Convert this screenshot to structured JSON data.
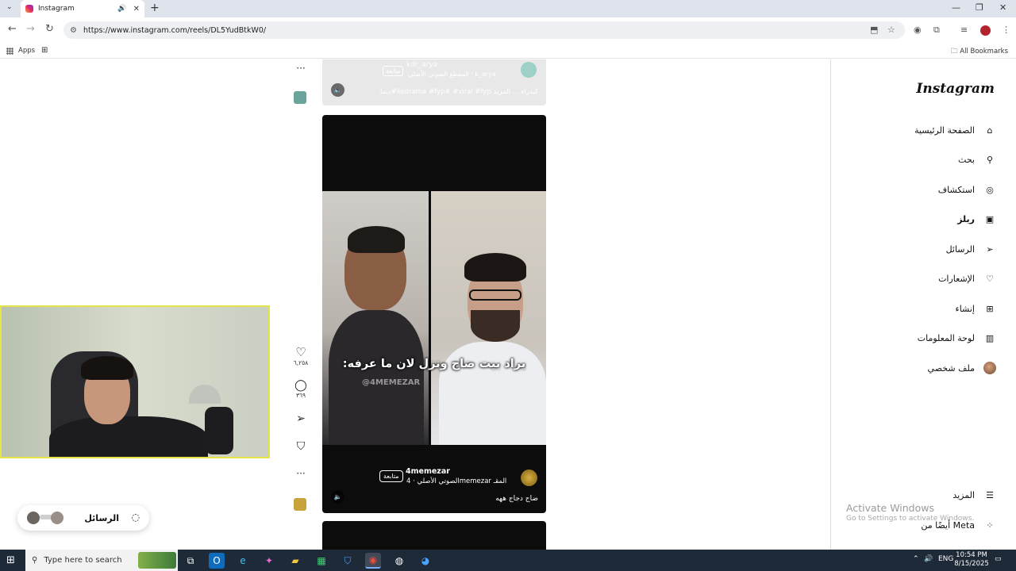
{
  "browser": {
    "tab_title": "Instagram",
    "url": "https://www.instagram.com/reels/DL5YudBtkW0/",
    "bookmarks": {
      "apps_label": "Apps",
      "all_bookmarks_label": "All Bookmarks"
    }
  },
  "sidebar": {
    "logo": "Instagram",
    "items": [
      {
        "label": "الصفحة الرئيسية",
        "icon": "home-icon",
        "glyph": "⌂"
      },
      {
        "label": "بحث",
        "icon": "search-icon",
        "glyph": "⚲"
      },
      {
        "label": "استكشاف",
        "icon": "compass-icon",
        "glyph": "◎"
      },
      {
        "label": "ريلز",
        "icon": "reels-icon",
        "glyph": "▣"
      },
      {
        "label": "الرسائل",
        "icon": "send-icon",
        "glyph": "➢"
      },
      {
        "label": "الإشعارات",
        "icon": "heart-icon",
        "glyph": "♡"
      },
      {
        "label": "إنشاء",
        "icon": "plus-square-icon",
        "glyph": "⊞"
      },
      {
        "label": "لوحة المعلومات",
        "icon": "dashboard-icon",
        "glyph": "▥"
      },
      {
        "label": "ملف شخصي",
        "icon": "profile-avatar",
        "glyph": ""
      }
    ],
    "more_label": "المزيد",
    "meta_label": "أيضًا من Meta"
  },
  "reel_previous": {
    "username": "kdr_arya",
    "sound": "المقطع الصوتي الأصلي · k_arya",
    "follow_label": "متابعة",
    "caption": "ديما#kedrama #fyp# #viral #fyp كيدراء ... المزيد"
  },
  "reel_current": {
    "overlay_text": "يراد بيت ضاج ونزل لان ما عرفه:",
    "watermark": "@4MEMEZAR",
    "username": "4memezar",
    "sound": "الصوتي الأصلي · 4memezar المقـ",
    "follow_label": "متابعة",
    "caption": "ضاج دجاج ههه"
  },
  "actions": {
    "likes": "٦,٢٥٨",
    "comments": "٣٦٩",
    "more": "···"
  },
  "messages_pill": {
    "label": "الرسائل"
  },
  "watermark": {
    "title": "Activate Windows",
    "subtitle": "Go to Settings to activate Windows."
  },
  "taskbar": {
    "search_placeholder": "Type here to search",
    "language": "ENG",
    "time": "10:54 PM",
    "date": "8/15/2025"
  }
}
